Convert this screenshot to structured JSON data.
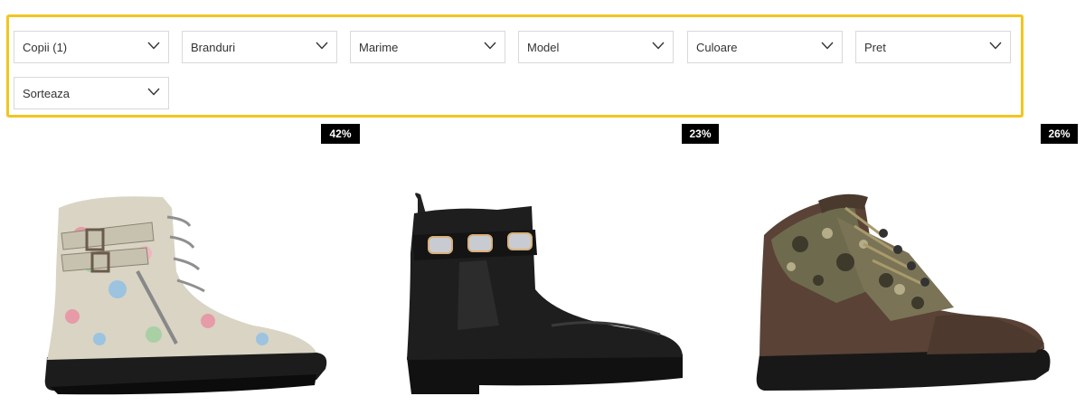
{
  "filters": [
    {
      "label": "Copii (1)",
      "icon": "chevron-down-icon"
    },
    {
      "label": "Branduri",
      "icon": "chevron-down-icon"
    },
    {
      "label": "Marime",
      "icon": "chevron-down-icon"
    },
    {
      "label": "Model",
      "icon": "chevron-down-icon"
    },
    {
      "label": "Culoare",
      "icon": "chevron-down-icon"
    },
    {
      "label": "Pret",
      "icon": "chevron-down-icon"
    },
    {
      "label": "Sorteaza",
      "icon": "chevron-down-icon"
    }
  ],
  "products": [
    {
      "discount": "42%",
      "image": "floral-lace-up-boot"
    },
    {
      "discount": "23%",
      "image": "black-jeweled-chelsea-boot"
    },
    {
      "discount": "26%",
      "image": "brown-camo-hiker-boot"
    }
  ],
  "colors": {
    "highlight_border": "#f2c51f",
    "badge_bg": "#000000",
    "badge_text": "#ffffff"
  }
}
